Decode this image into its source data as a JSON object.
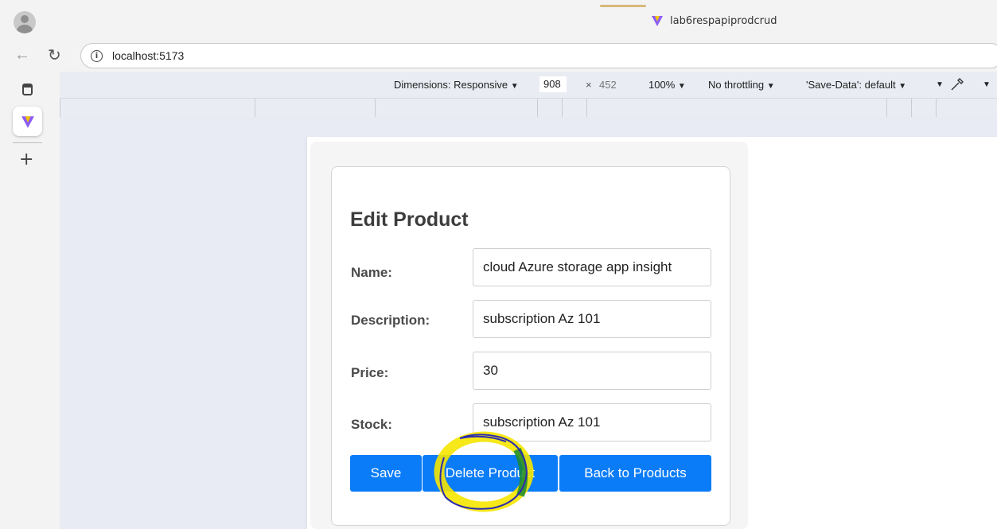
{
  "browser": {
    "tab_title": "lab6respapiprodcrud",
    "url": "localhost:5173"
  },
  "devtools": {
    "dimensions_label": "Dimensions: Responsive",
    "width": "908",
    "times": "×",
    "height": "452",
    "zoom": "100%",
    "throttling": "No throttling",
    "save_data": "'Save-Data': default"
  },
  "form": {
    "title": "Edit Product",
    "fields": [
      {
        "label": "Name:",
        "value": "cloud Azure storage app insight"
      },
      {
        "label": "Description:",
        "value": "subscription Az 101"
      },
      {
        "label": "Price:",
        "value": "30"
      },
      {
        "label": "Stock:",
        "value": "subscription Az 101"
      }
    ],
    "buttons": {
      "save": "Save",
      "delete": "Delete Product",
      "back": "Back to Products"
    }
  },
  "colors": {
    "button_blue": "#0a7cf7",
    "highlight_yellow": "#f5e600",
    "pen_green": "#1a8a2e",
    "pen_blue": "#2b2bb0"
  }
}
